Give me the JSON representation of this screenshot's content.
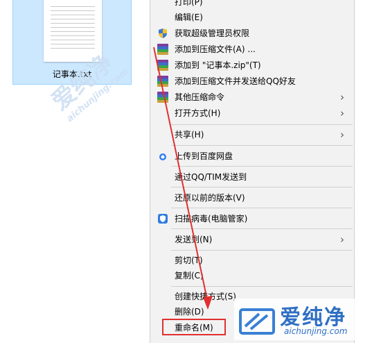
{
  "file": {
    "name": "记事本.txt"
  },
  "menu": {
    "items": [
      {
        "label": "打印(P)",
        "top": 0
      },
      {
        "label": "编辑(E)"
      },
      {
        "label": "获取超级管理员权限"
      },
      {
        "label": "添加到压缩文件(A) ..."
      },
      {
        "label": "添加到 \"记事本.zip\"(T)"
      },
      {
        "label": "添加到压缩文件并发送给QQ好友"
      },
      {
        "label": "其他压缩命令"
      },
      {
        "label": "打开方式(H)"
      },
      {
        "label": "共享(H)"
      },
      {
        "label": "上传到百度网盘"
      },
      {
        "label": "通过QQ/TIM发送到"
      },
      {
        "label": "还原以前的版本(V)"
      },
      {
        "label": "扫描病毒(电脑管家)"
      },
      {
        "label": "发送到(N)"
      },
      {
        "label": "剪切(T)"
      },
      {
        "label": "复制(C)"
      },
      {
        "label": "创建快捷方式(S)"
      },
      {
        "label": "删除(D)"
      },
      {
        "label": "重命名(M)"
      }
    ]
  },
  "watermark": {
    "brand": "爱纯净",
    "url": "aichunjing.com"
  },
  "colors": {
    "highlight_red": "#e03030",
    "selection_blue": "#cce8ff"
  }
}
